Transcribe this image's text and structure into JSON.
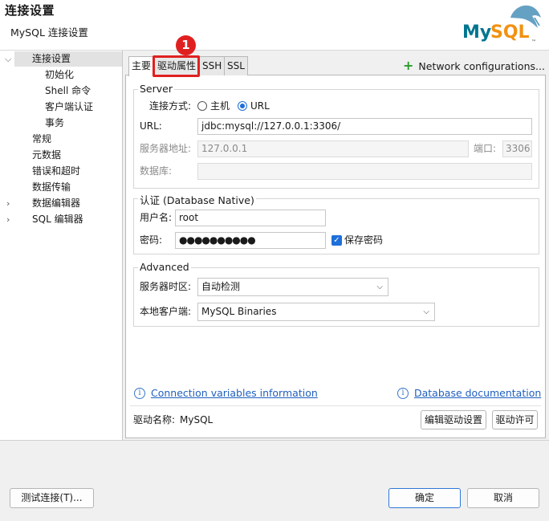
{
  "window": {
    "title": "连接设置",
    "subtitle": "MySQL 连接设置",
    "logo_text": "MySQL"
  },
  "sidebar": {
    "items": [
      {
        "label": "连接设置",
        "expanded": true,
        "selected": true
      },
      {
        "label": "初始化"
      },
      {
        "label": "Shell 命令"
      },
      {
        "label": "客户端认证"
      },
      {
        "label": "事务"
      },
      {
        "label": "常规"
      },
      {
        "label": "元数据"
      },
      {
        "label": "错误和超时"
      },
      {
        "label": "数据传输"
      },
      {
        "label": "数据编辑器",
        "collapsed": true
      },
      {
        "label": "SQL 编辑器",
        "collapsed": true
      }
    ]
  },
  "tabs": [
    {
      "label": "主要",
      "active": true
    },
    {
      "label": "驱动属性"
    },
    {
      "label": "SSH"
    },
    {
      "label": "SSL"
    }
  ],
  "network_config": {
    "label": "Network configurations..."
  },
  "server": {
    "group_title": "Server",
    "connect_mode_label": "连接方式:",
    "radio_host": "主机",
    "radio_url": "URL",
    "selected_mode": "URL",
    "url_label": "URL:",
    "url_value": "jdbc:mysql://127.0.0.1:3306/",
    "host_label": "服务器地址:",
    "host_value": "127.0.0.1",
    "port_label": "端口:",
    "port_value": "3306",
    "db_label": "数据库:",
    "db_value": ""
  },
  "auth": {
    "group_title": "认证 (Database Native)",
    "user_label": "用户名:",
    "user_value": "root",
    "password_label": "密码:",
    "password_value": "●●●●●●●●●●",
    "save_password_label": "保存密码",
    "save_password_checked": true
  },
  "advanced": {
    "group_title": "Advanced",
    "timezone_label": "服务器时区:",
    "timezone_value": "自动检测",
    "client_label": "本地客户端:",
    "client_value": "MySQL Binaries"
  },
  "links": {
    "connection_vars": "Connection variables information",
    "db_docs": "Database documentation"
  },
  "driver": {
    "label": "驱动名称:",
    "name": "MySQL",
    "edit_button": "编辑驱动设置",
    "license_button": "驱动许可"
  },
  "footer": {
    "test_button": "测试连接(T)...",
    "ok_button": "确定",
    "cancel_button": "取消"
  },
  "annotation": {
    "marker": "1",
    "color": "#e02020"
  },
  "colors": {
    "accent": "#1e6fd9",
    "link": "#1f5fbf",
    "add_icon": "#2a9a2a"
  }
}
